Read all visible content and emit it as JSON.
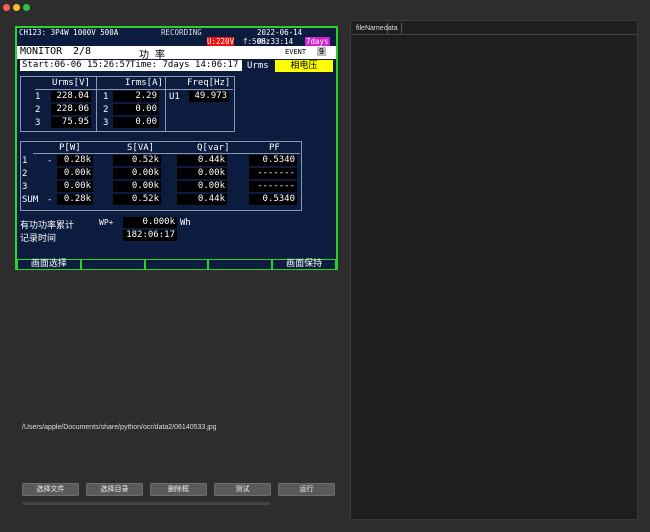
{
  "device": {
    "status_left": "CH123:  3P4W   1000V  500A",
    "recording": "RECORDING",
    "datetime": "2022-06-14 06:33:14",
    "u_range": "U:220V",
    "freq": "f:50Hz",
    "days": "7days",
    "monitor": "MONITOR",
    "page": "2/8",
    "title": "功  率",
    "event": "EVENT",
    "event_count": "9",
    "start": "Start:06-06 15:26:57",
    "time": "Time:  7days 14:06:17",
    "urms_label": "Urms",
    "phase_label": "相电压",
    "urms_header": "Urms[V]",
    "irms_header": "Irms[A]",
    "freq_header": "Freq[Hz]",
    "urms": [
      {
        "n": "1",
        "v": "228.04"
      },
      {
        "n": "2",
        "v": "228.06"
      },
      {
        "n": "3",
        "v": "75.95"
      }
    ],
    "irms": [
      {
        "n": "1",
        "v": "2.29"
      },
      {
        "n": "2",
        "v": "0.00"
      },
      {
        "n": "3",
        "v": "0.00"
      }
    ],
    "freq_ch": "U1",
    "freq_val": "49.973",
    "power_headers": [
      "P[W]",
      "S[VA]",
      "Q[var]",
      "PF"
    ],
    "power_rows": [
      {
        "label": "1",
        "sign": "-",
        "p": "0.28k",
        "s": "0.52k",
        "q": "0.44k",
        "pf": "0.5340"
      },
      {
        "label": "2",
        "sign": "",
        "p": "0.00k",
        "s": "0.00k",
        "q": "0.00k",
        "pf": "-------"
      },
      {
        "label": "3",
        "sign": "",
        "p": "0.00k",
        "s": "0.00k",
        "q": "0.00k",
        "pf": "-------"
      },
      {
        "label": "SUM",
        "sign": "-",
        "p": "0.28k",
        "s": "0.52k",
        "q": "0.44k",
        "pf": "0.5340"
      }
    ],
    "energy_label": "有功功率累计",
    "wp_label": "WP+",
    "energy_value": "0.000k",
    "energy_unit": "Wh",
    "rec_label": "记录时间",
    "rec_value": "182:06:17",
    "softkeys": [
      "画面选择",
      "",
      "",
      "",
      "画面保持"
    ]
  },
  "file_path": "/Users/apple/Documents/share/python/ocr/data2/06140533.jpg",
  "buttons": [
    "选择文件",
    "选择目录",
    "删除框",
    "测试",
    "运行"
  ],
  "right_tabs": [
    "fileName",
    "data"
  ],
  "colors": {
    "screen_bg": "#0b1c3e",
    "border_green": "#29d329",
    "highlight": "#ffff00"
  }
}
